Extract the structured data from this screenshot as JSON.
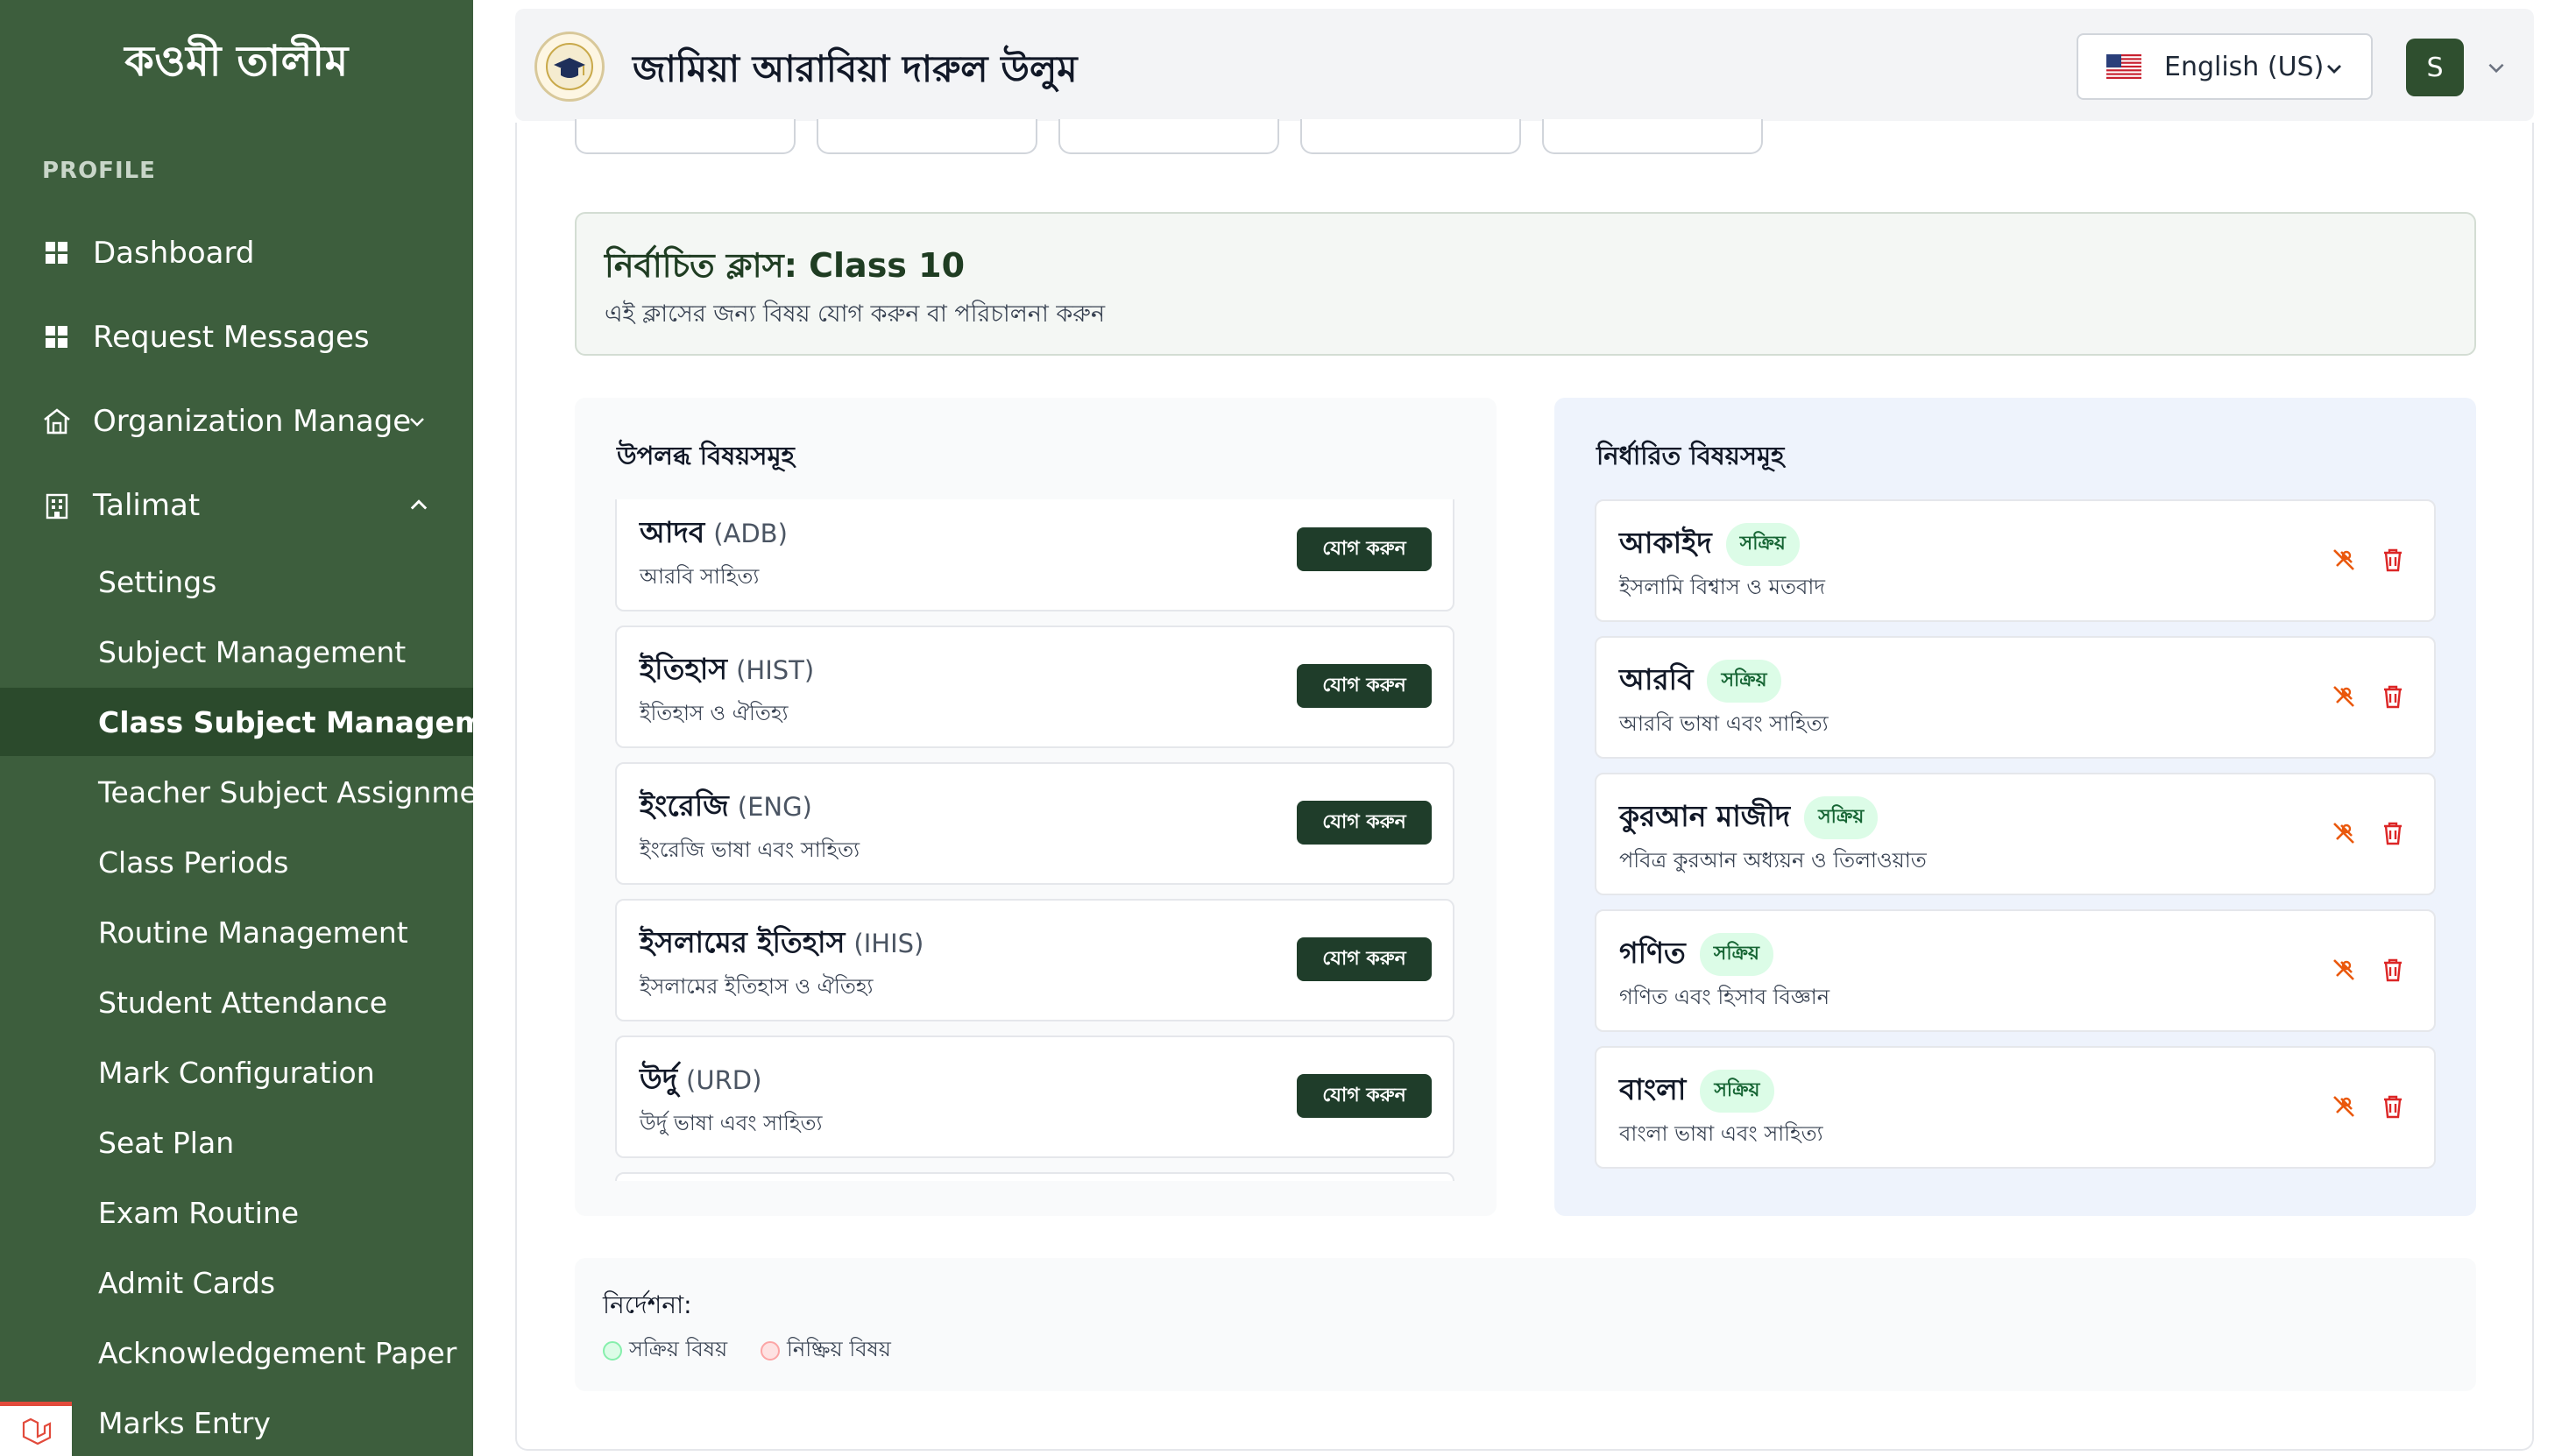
{
  "sidebar": {
    "brand": "কওমী তালীম",
    "section_label": "PROFILE",
    "items": [
      {
        "label": "Dashboard",
        "icon": "grid-icon"
      },
      {
        "label": "Request Messages",
        "icon": "grid-icon"
      },
      {
        "label": "Organization Manage",
        "icon": "house-icon"
      },
      {
        "label": "Talimat",
        "icon": "building-icon"
      }
    ],
    "sub_items": [
      "Settings",
      "Subject Management",
      "Class Subject Management",
      "Teacher Subject Assignment",
      "Class Periods",
      "Routine Management",
      "Student Attendance",
      "Mark Configuration",
      "Seat Plan",
      "Exam Routine",
      "Admit Cards",
      "Acknowledgement Paper",
      "Marks Entry"
    ],
    "active_sub_item": "Class Subject Management"
  },
  "header": {
    "org_name": "জামিয়া আরাবিয়া দারুল উলুম",
    "language": "English (US)",
    "user_initial": "S"
  },
  "selected_class": {
    "title": "নির্বাচিত ক্লাস: Class 10",
    "description": "এই ক্লাসের জন্য বিষয় যোগ করুন বা পরিচালনা করুন"
  },
  "available": {
    "title": "উপলব্ধ বিষয়সমূহ",
    "add_label": "যোগ করুন",
    "subjects": [
      {
        "name": "আদব",
        "code": "(ADB)",
        "desc": "আরবি সাহিত্য"
      },
      {
        "name": "ইতিহাস",
        "code": "(HIST)",
        "desc": "ইতিহাস ও ঐতিহ্য"
      },
      {
        "name": "ইংরেজি",
        "code": "(ENG)",
        "desc": "ইংরেজি ভাষা এবং সাহিত্য"
      },
      {
        "name": "ইসলামের ইতিহাস",
        "code": "(IHIS)",
        "desc": "ইসলামের ইতিহাস ও ঐতিহ্য"
      },
      {
        "name": "উর্দু",
        "code": "(URD)",
        "desc": "উর্দু ভাষা এবং সাহিত্য"
      }
    ]
  },
  "assigned": {
    "title": "নির্ধারিত বিষয়সমূহ",
    "subjects": [
      {
        "name": "আকাইদ",
        "status": "সক্রিয়",
        "desc": "ইসলামি বিশ্বাস ও মতবাদ"
      },
      {
        "name": "আরবি",
        "status": "সক্রিয়",
        "desc": "আরবি ভাষা এবং সাহিত্য"
      },
      {
        "name": "কুরআন মাজীদ",
        "status": "সক্রিয়",
        "desc": "পবিত্র কুরআন অধ্যয়ন ও তিলাওয়াত"
      },
      {
        "name": "গণিত",
        "status": "সক্রিয়",
        "desc": "গণিত এবং হিসাব বিজ্ঞান"
      },
      {
        "name": "বাংলা",
        "status": "সক্রিয়",
        "desc": "বাংলা ভাষা এবং সাহিত্য"
      }
    ]
  },
  "legend": {
    "title": "নির্দেশনা:",
    "active": "সক্রিয় বিষয়",
    "inactive": "নিষ্ক্রিয় বিষয়"
  },
  "colors": {
    "sidebar_bg": "#3d5e3d",
    "active_item_bg": "#2b4a2c",
    "primary_button": "#1f3d2a",
    "active_badge_bg": "#dcfce7",
    "delete_icon": "#dc2626",
    "toggle_icon": "#ea580c"
  }
}
